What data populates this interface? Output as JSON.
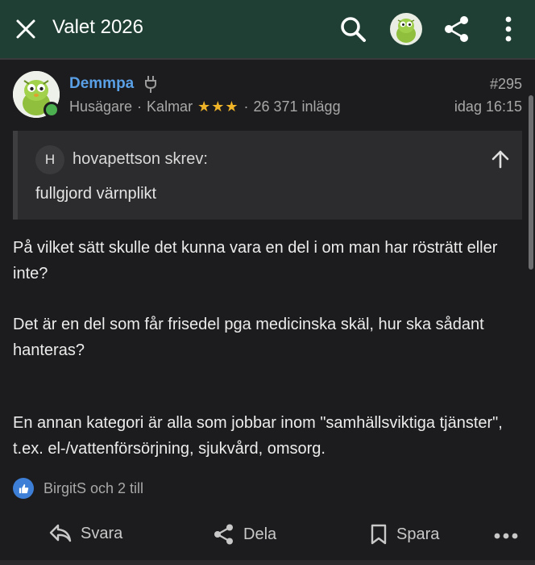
{
  "topbar": {
    "title": "Valet 2026"
  },
  "post": {
    "username": "Demmpa",
    "role": "Husägare",
    "location": "Kalmar",
    "meta_separator": "·",
    "stars": "★★★",
    "post_count": "26 371 inlägg",
    "post_number": "#295",
    "time": "idag 16:15",
    "quote": {
      "avatar_letter": "H",
      "author": "hovapettson skrev:",
      "text": "fullgjord värnplikt"
    },
    "paragraphs": [
      "På vilket sätt skulle det kunna vara en del i om man har rösträtt eller inte?",
      "Det är en del som får frisedel pga medicinska skäl, hur ska sådant hanteras?",
      "En annan kategori är alla som jobbar inom \"samhällsviktiga tjänster\", t.ex. el-/vattenförsörjning, sjukvård, omsorg."
    ],
    "reactions": "BirgitS och 2 till"
  },
  "actions": {
    "reply": "Svara",
    "share": "Dela",
    "save": "Spara"
  },
  "colors": {
    "topbar": "#1f3f35",
    "background": "#1c1c1e",
    "username": "#5aa0e6",
    "stars": "#f0b429",
    "like": "#3d7fd6",
    "online": "#4caf50"
  },
  "icons": [
    "close-icon",
    "search-icon",
    "avatar",
    "share-icon",
    "more-vertical-icon",
    "plug-icon",
    "arrow-up-icon",
    "like-icon",
    "reply-icon",
    "bookmark-icon",
    "more-horizontal-icon"
  ]
}
